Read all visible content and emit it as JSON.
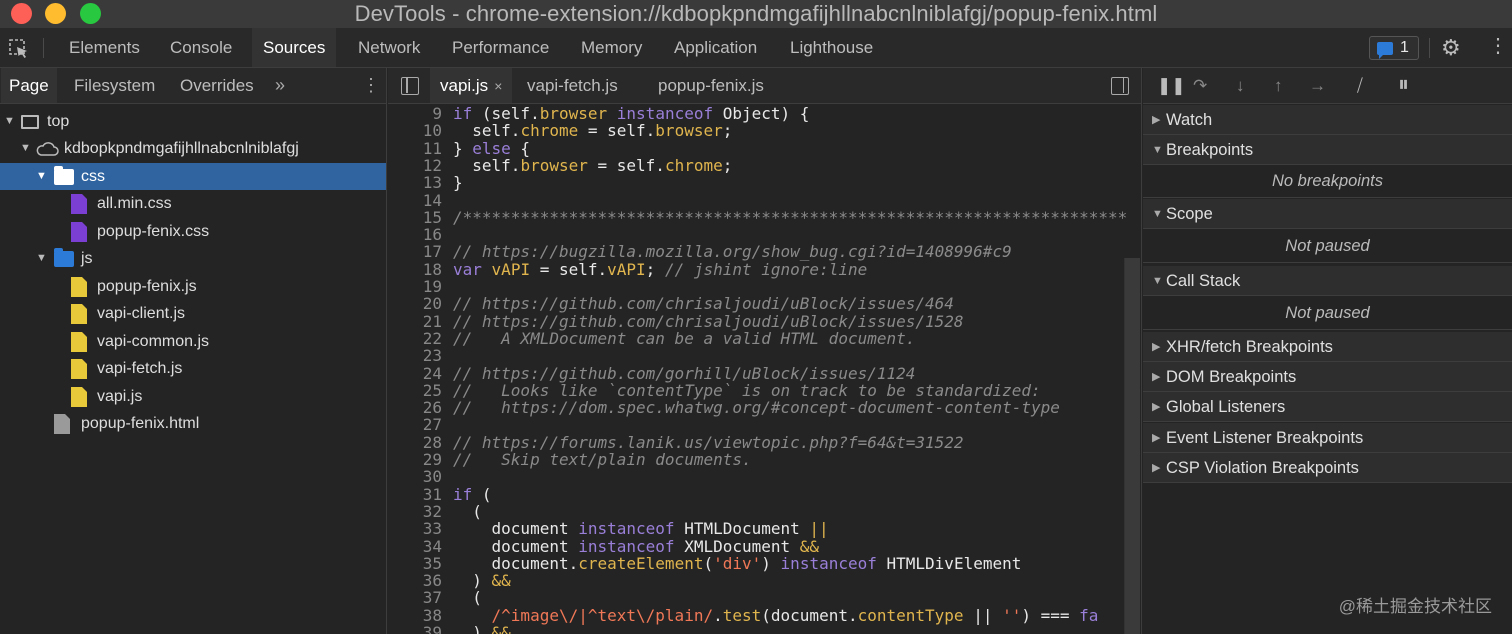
{
  "window": {
    "title": "DevTools - chrome-extension://kdbopkpndmgafijhllnabcnlniblafgj/popup-fenix.html"
  },
  "main_tabs": [
    "Elements",
    "Console",
    "Sources",
    "Network",
    "Performance",
    "Memory",
    "Application",
    "Lighthouse"
  ],
  "main_tabs_active": "Sources",
  "issues_count": "1",
  "navigator": {
    "tabs": [
      "Page",
      "Filesystem",
      "Overrides"
    ],
    "more": "»",
    "tree": [
      {
        "label": "top",
        "icon": "frame-icon",
        "expanded": true
      },
      {
        "label": "kdbopkpndmgafijhllnabcnlniblafgj",
        "icon": "cloud-icon",
        "expanded": true
      },
      {
        "label": "css",
        "icon": "folder-icon",
        "expanded": true,
        "selected": true
      },
      {
        "label": "all.min.css",
        "icon": "css-file-icon"
      },
      {
        "label": "popup-fenix.css",
        "icon": "css-file-icon"
      },
      {
        "label": "js",
        "icon": "folder-icon",
        "expanded": true
      },
      {
        "label": "popup-fenix.js",
        "icon": "js-file-icon"
      },
      {
        "label": "vapi-client.js",
        "icon": "js-file-icon"
      },
      {
        "label": "vapi-common.js",
        "icon": "js-file-icon"
      },
      {
        "label": "vapi-fetch.js",
        "icon": "js-file-icon"
      },
      {
        "label": "vapi.js",
        "icon": "js-file-icon"
      },
      {
        "label": "popup-fenix.html",
        "icon": "html-file-icon"
      }
    ]
  },
  "editor": {
    "tabs": [
      {
        "label": "vapi.js",
        "active": true,
        "closable": true,
        "close": "×"
      },
      {
        "label": "vapi-fetch.js"
      },
      {
        "label": "popup-fenix.js"
      }
    ],
    "code_lines": [
      {
        "n": "9",
        "html": "<span class='k'>if</span> (self.<span class='p'>browser</span> <span class='k'>instanceof</span> Object) {"
      },
      {
        "n": "10",
        "html": "  self.<span class='p'>chrome</span> = self.<span class='p'>browser</span>;"
      },
      {
        "n": "11",
        "html": "} <span class='k'>else</span> {"
      },
      {
        "n": "12",
        "html": "  self.<span class='p'>browser</span> = self.<span class='p'>chrome</span>;"
      },
      {
        "n": "13",
        "html": "}"
      },
      {
        "n": "14",
        "html": ""
      },
      {
        "n": "15",
        "html": "<span class='c'>/*****************************************************************************</span>"
      },
      {
        "n": "16",
        "html": ""
      },
      {
        "n": "17",
        "html": "<span class='c'>// https://bugzilla.mozilla.org/show_bug.cgi?id=1408996#c9</span>"
      },
      {
        "n": "18",
        "html": "<span class='k'>var</span> <span class='p'>vAPI</span> = self.<span class='p'>vAPI</span>; <span class='c'>// jshint ignore:line</span>"
      },
      {
        "n": "19",
        "html": ""
      },
      {
        "n": "20",
        "html": "<span class='c'>// https://github.com/chrisaljoudi/uBlock/issues/464</span>"
      },
      {
        "n": "21",
        "html": "<span class='c'>// https://github.com/chrisaljoudi/uBlock/issues/1528</span>"
      },
      {
        "n": "22",
        "html": "<span class='c'>//   A XMLDocument can be a valid HTML document.</span>"
      },
      {
        "n": "23",
        "html": ""
      },
      {
        "n": "24",
        "html": "<span class='c'>// https://github.com/gorhill/uBlock/issues/1124</span>"
      },
      {
        "n": "25",
        "html": "<span class='c'>//   Looks like `contentType` is on track to be standardized:</span>"
      },
      {
        "n": "26",
        "html": "<span class='c'>//   https://dom.spec.whatwg.org/#concept-document-content-type</span>"
      },
      {
        "n": "27",
        "html": ""
      },
      {
        "n": "28",
        "html": "<span class='c'>// https://forums.lanik.us/viewtopic.php?f=64&amp;t=31522</span>"
      },
      {
        "n": "29",
        "html": "<span class='c'>//   Skip text/plain documents.</span>"
      },
      {
        "n": "30",
        "html": ""
      },
      {
        "n": "31",
        "html": "<span class='k'>if</span> ("
      },
      {
        "n": "32",
        "html": "  ("
      },
      {
        "n": "33",
        "html": "    document <span class='k'>instanceof</span> HTMLDocument <span class='p'>||</span>"
      },
      {
        "n": "34",
        "html": "    document <span class='k'>instanceof</span> XMLDocument <span class='p'>&amp;&amp;</span>"
      },
      {
        "n": "35",
        "html": "    document.<span class='p'>createElement</span>(<span class='s'>'div'</span>) <span class='k'>instanceof</span> HTMLDivElement"
      },
      {
        "n": "36",
        "html": "  ) <span class='p'>&amp;&amp;</span>"
      },
      {
        "n": "37",
        "html": "  ("
      },
      {
        "n": "38",
        "html": "    <span class='r'>/^image\\/|^text\\/plain/</span>.<span class='p'>test</span>(document.<span class='p'>contentType</span> || <span class='s'>''</span>) === <span class='k'>fa</span>"
      },
      {
        "n": "39",
        "html": "  ) <span class='p'>&amp;&amp;</span>"
      }
    ]
  },
  "debugger": {
    "sections": [
      {
        "label": "Watch",
        "expanded": false
      },
      {
        "label": "Breakpoints",
        "expanded": true,
        "info": "No breakpoints"
      },
      {
        "label": "Scope",
        "expanded": true,
        "info": "Not paused"
      },
      {
        "label": "Call Stack",
        "expanded": true,
        "info": "Not paused"
      },
      {
        "label": "XHR/fetch Breakpoints",
        "expanded": false
      },
      {
        "label": "DOM Breakpoints",
        "expanded": false
      },
      {
        "label": "Global Listeners",
        "expanded": false
      },
      {
        "label": "Event Listener Breakpoints",
        "expanded": false
      },
      {
        "label": "CSP Violation Breakpoints",
        "expanded": false
      }
    ]
  },
  "watermark": "@稀土掘金技术社区",
  "colors": {
    "selection": "#2f64a0",
    "keyword": "#9a7fd8",
    "property": "#e0b54e",
    "string": "#f07857",
    "css_file": "#7b3fd4",
    "js_file": "#e8c93a",
    "folder": "#2d7bd8"
  }
}
